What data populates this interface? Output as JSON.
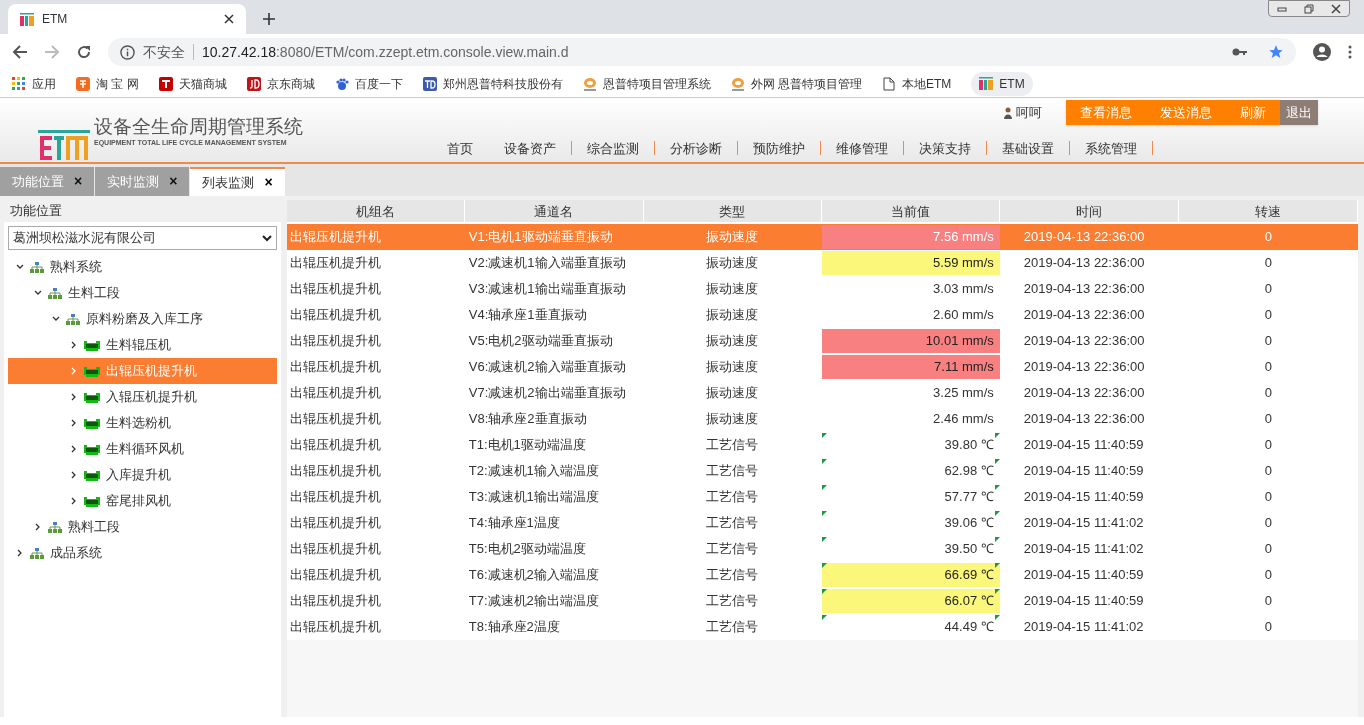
{
  "browser": {
    "tab_title": "ETM",
    "address_security": "不安全",
    "address_host": "10.27.42.18",
    "address_path": ":8080/ETM/com.zzept.etm.console.view.main.d",
    "bookmarks": [
      {
        "label": "应用",
        "kind": "apps"
      },
      {
        "label": "淘 宝 网",
        "kind": "taobao"
      },
      {
        "label": "天猫商城",
        "kind": "tmall"
      },
      {
        "label": "京东商城",
        "kind": "jd"
      },
      {
        "label": "百度一下",
        "kind": "baidu"
      },
      {
        "label": "郑州恩普特科技股份有",
        "kind": "td"
      },
      {
        "label": "恩普特项目管理系统",
        "kind": "expert"
      },
      {
        "label": "外网 恩普特项目管理",
        "kind": "expert"
      },
      {
        "label": "本地ETM",
        "kind": "page"
      },
      {
        "label": "ETM",
        "kind": "etm"
      }
    ]
  },
  "header": {
    "title": "设备全生命周期管理系统",
    "subtitle": "EQUIPMENT TOTAL LIFE CYCLE MANAGEMENT SYSTEM",
    "user": "呵呵",
    "actions": [
      {
        "label": "查看消息",
        "kind": "primary"
      },
      {
        "label": "发送消息",
        "kind": "primary"
      },
      {
        "label": "刷新",
        "kind": "primary"
      },
      {
        "label": "退出",
        "kind": "exit"
      }
    ],
    "nav": [
      "首页",
      "设备资产",
      "综合监测",
      "分析诊断",
      "预防维护",
      "维修管理",
      "决策支持",
      "基础设置",
      "系统管理"
    ]
  },
  "tabs": [
    {
      "label": "功能位置",
      "close": "×",
      "selected": false
    },
    {
      "label": "实时监测",
      "close": "×",
      "selected": false
    },
    {
      "label": "列表监测",
      "close": "×",
      "selected": true
    }
  ],
  "sidebar": {
    "title": "功能位置",
    "company": "葛洲坝松滋水泥有限公司",
    "tree": [
      {
        "label": "熟料系统",
        "kind": "group",
        "expanded": true,
        "selected": false,
        "children": [
          {
            "label": "生料工段",
            "kind": "group",
            "expanded": true,
            "selected": false,
            "children": [
              {
                "label": "原料粉磨及入库工序",
                "kind": "group",
                "expanded": true,
                "selected": false,
                "children": [
                  {
                    "label": "生料辊压机",
                    "kind": "equipment",
                    "expanded": false,
                    "selected": false
                  },
                  {
                    "label": "出辊压机提升机",
                    "kind": "equipment",
                    "expanded": false,
                    "selected": true
                  },
                  {
                    "label": "入辊压机提升机",
                    "kind": "equipment",
                    "expanded": false,
                    "selected": false
                  },
                  {
                    "label": "生料选粉机",
                    "kind": "equipment",
                    "expanded": false,
                    "selected": false
                  },
                  {
                    "label": "生料循环风机",
                    "kind": "equipment",
                    "expanded": false,
                    "selected": false
                  },
                  {
                    "label": "入库提升机",
                    "kind": "equipment",
                    "expanded": false,
                    "selected": false
                  },
                  {
                    "label": "窑尾排风机",
                    "kind": "equipment",
                    "expanded": false,
                    "selected": false
                  }
                ]
              }
            ]
          },
          {
            "label": "熟料工段",
            "kind": "group",
            "expanded": false,
            "selected": false
          }
        ]
      },
      {
        "label": "成品系统",
        "kind": "group",
        "expanded": false,
        "selected": false
      }
    ]
  },
  "table": {
    "columns": [
      "机组名",
      "通道名",
      "类型",
      "当前值",
      "时间",
      "转速"
    ],
    "rows": [
      {
        "unit": "出辊压机提升机",
        "channel": "V1:电机1驱动端垂直振动",
        "type": "振动速度",
        "value": "7.56 mm/s",
        "color": "#f88080",
        "marked": false,
        "time": "2019-04-13 22:36:00",
        "speed": "0",
        "selected": true
      },
      {
        "unit": "出辊压机提升机",
        "channel": "V2:减速机1输入端垂直振动",
        "type": "振动速度",
        "value": "5.59 mm/s",
        "color": "#fbf77a",
        "marked": false,
        "time": "2019-04-13 22:36:00",
        "speed": "0",
        "selected": false
      },
      {
        "unit": "出辊压机提升机",
        "channel": "V3:减速机1输出端垂直振动",
        "type": "振动速度",
        "value": "3.03 mm/s",
        "marked": false,
        "time": "2019-04-13 22:36:00",
        "speed": "0",
        "selected": false
      },
      {
        "unit": "出辊压机提升机",
        "channel": "V4:轴承座1垂直振动",
        "type": "振动速度",
        "value": "2.60 mm/s",
        "marked": false,
        "time": "2019-04-13 22:36:00",
        "speed": "0",
        "selected": false
      },
      {
        "unit": "出辊压机提升机",
        "channel": "V5:电机2驱动端垂直振动",
        "type": "振动速度",
        "value": "10.01 mm/s",
        "color": "#f88080",
        "marked": false,
        "time": "2019-04-13 22:36:00",
        "speed": "0",
        "selected": false
      },
      {
        "unit": "出辊压机提升机",
        "channel": "V6:减速机2输入端垂直振动",
        "type": "振动速度",
        "value": "7.11 mm/s",
        "color": "#f88080",
        "marked": false,
        "time": "2019-04-13 22:36:00",
        "speed": "0",
        "selected": false
      },
      {
        "unit": "出辊压机提升机",
        "channel": "V7:减速机2输出端垂直振动",
        "type": "振动速度",
        "value": "3.25 mm/s",
        "marked": false,
        "time": "2019-04-13 22:36:00",
        "speed": "0",
        "selected": false
      },
      {
        "unit": "出辊压机提升机",
        "channel": "V8:轴承座2垂直振动",
        "type": "振动速度",
        "value": "2.46 mm/s",
        "marked": false,
        "time": "2019-04-13 22:36:00",
        "speed": "0",
        "selected": false
      },
      {
        "unit": "出辊压机提升机",
        "channel": "T1:电机1驱动端温度",
        "type": "工艺信号",
        "value": "39.80 ℃",
        "marked": true,
        "time": "2019-04-15 11:40:59",
        "speed": "0",
        "selected": false
      },
      {
        "unit": "出辊压机提升机",
        "channel": "T2:减速机1输入端温度",
        "type": "工艺信号",
        "value": "62.98 ℃",
        "marked": true,
        "time": "2019-04-15 11:40:59",
        "speed": "0",
        "selected": false
      },
      {
        "unit": "出辊压机提升机",
        "channel": "T3:减速机1输出端温度",
        "type": "工艺信号",
        "value": "57.77 ℃",
        "marked": true,
        "time": "2019-04-15 11:40:59",
        "speed": "0",
        "selected": false
      },
      {
        "unit": "出辊压机提升机",
        "channel": "T4:轴承座1温度",
        "type": "工艺信号",
        "value": "39.06 ℃",
        "marked": true,
        "time": "2019-04-15 11:41:02",
        "speed": "0",
        "selected": false
      },
      {
        "unit": "出辊压机提升机",
        "channel": "T5:电机2驱动端温度",
        "type": "工艺信号",
        "value": "39.50 ℃",
        "marked": true,
        "time": "2019-04-15 11:41:02",
        "speed": "0",
        "selected": false
      },
      {
        "unit": "出辊压机提升机",
        "channel": "T6:减速机2输入端温度",
        "type": "工艺信号",
        "value": "66.69 ℃",
        "color": "#fbf77a",
        "marked": true,
        "time": "2019-04-15 11:40:59",
        "speed": "0",
        "selected": false
      },
      {
        "unit": "出辊压机提升机",
        "channel": "T7:减速机2输出端温度",
        "type": "工艺信号",
        "value": "66.07 ℃",
        "color": "#fbf77a",
        "marked": true,
        "time": "2019-04-15 11:40:59",
        "speed": "0",
        "selected": false
      },
      {
        "unit": "出辊压机提升机",
        "channel": "T8:轴承座2温度",
        "type": "工艺信号",
        "value": "44.49 ℃",
        "marked": true,
        "time": "2019-04-15 11:41:02",
        "speed": "0",
        "selected": false
      }
    ]
  }
}
